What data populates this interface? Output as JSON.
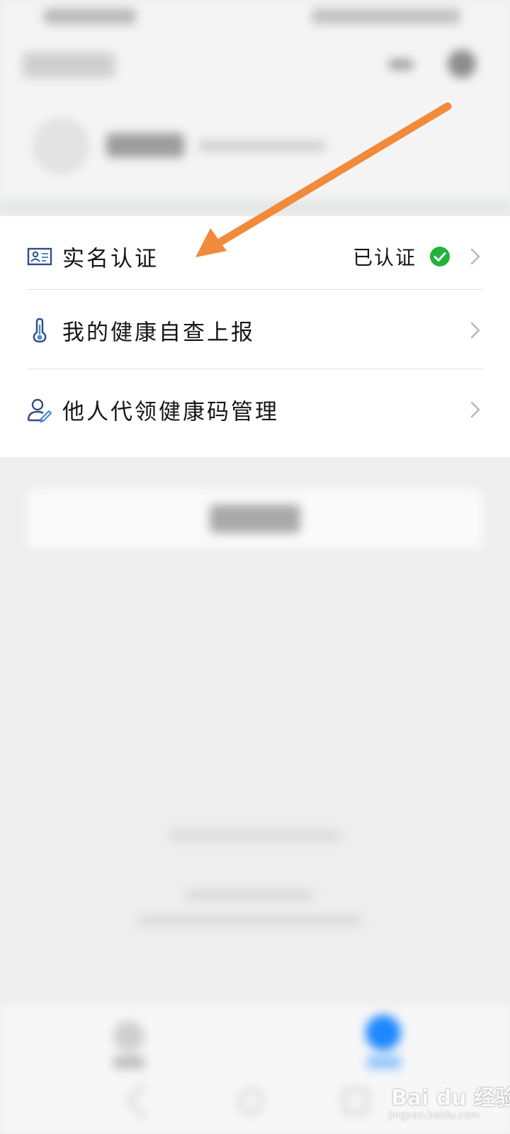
{
  "menu": {
    "items": [
      {
        "label": "实名认证",
        "status": "已认证",
        "icon": "id-card-icon",
        "status_icon": "check-circle-icon"
      },
      {
        "label": "我的健康自查上报",
        "icon": "thermometer-icon"
      },
      {
        "label": "他人代领健康码管理",
        "icon": "person-edit-icon"
      }
    ]
  },
  "annotation": {
    "arrow_color": "#f28a3b"
  },
  "colors": {
    "check_green": "#22b33a",
    "accent_blue": "#1e88ff",
    "icon_blue": "#2f5fa8"
  },
  "watermark": {
    "brand": "Bai du 经验",
    "domain": "jingyan.baidu.com"
  }
}
